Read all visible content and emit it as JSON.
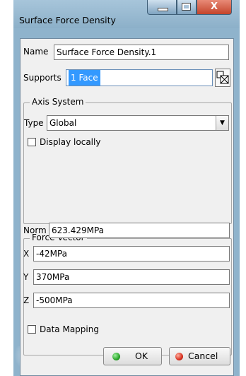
{
  "window": {
    "title": "Surface Force Density",
    "minimize_icon": "minimize-icon",
    "maximize_icon": "maximize-icon",
    "close_glyph": "X"
  },
  "name": {
    "label": "Name",
    "value": "Surface Force Density.1"
  },
  "supports": {
    "label": "Supports",
    "value": "1 Face",
    "selected_bg": "#3399ff",
    "icon": "face-selection-icon"
  },
  "axis_system": {
    "title": "Axis System",
    "type_label": "Type",
    "type_value": "Global",
    "dropdown_icon": "chevron-down-icon",
    "display_locally_label": "Display locally",
    "display_locally_checked": false
  },
  "force_vector": {
    "title": "Force Vector",
    "norm_label": "Norm",
    "norm_value": "623.429MPa",
    "x_label": "X",
    "x_value": "-42MPa",
    "y_label": "Y",
    "y_value": "370MPa",
    "z_label": "Z",
    "z_value": "-500MPa"
  },
  "data_mapping": {
    "label": "Data Mapping",
    "checked": false
  },
  "buttons": {
    "ok_label": "OK",
    "ok_icon_color": "#2aa52a",
    "cancel_label": "Cancel",
    "cancel_icon_color": "#d83020"
  }
}
